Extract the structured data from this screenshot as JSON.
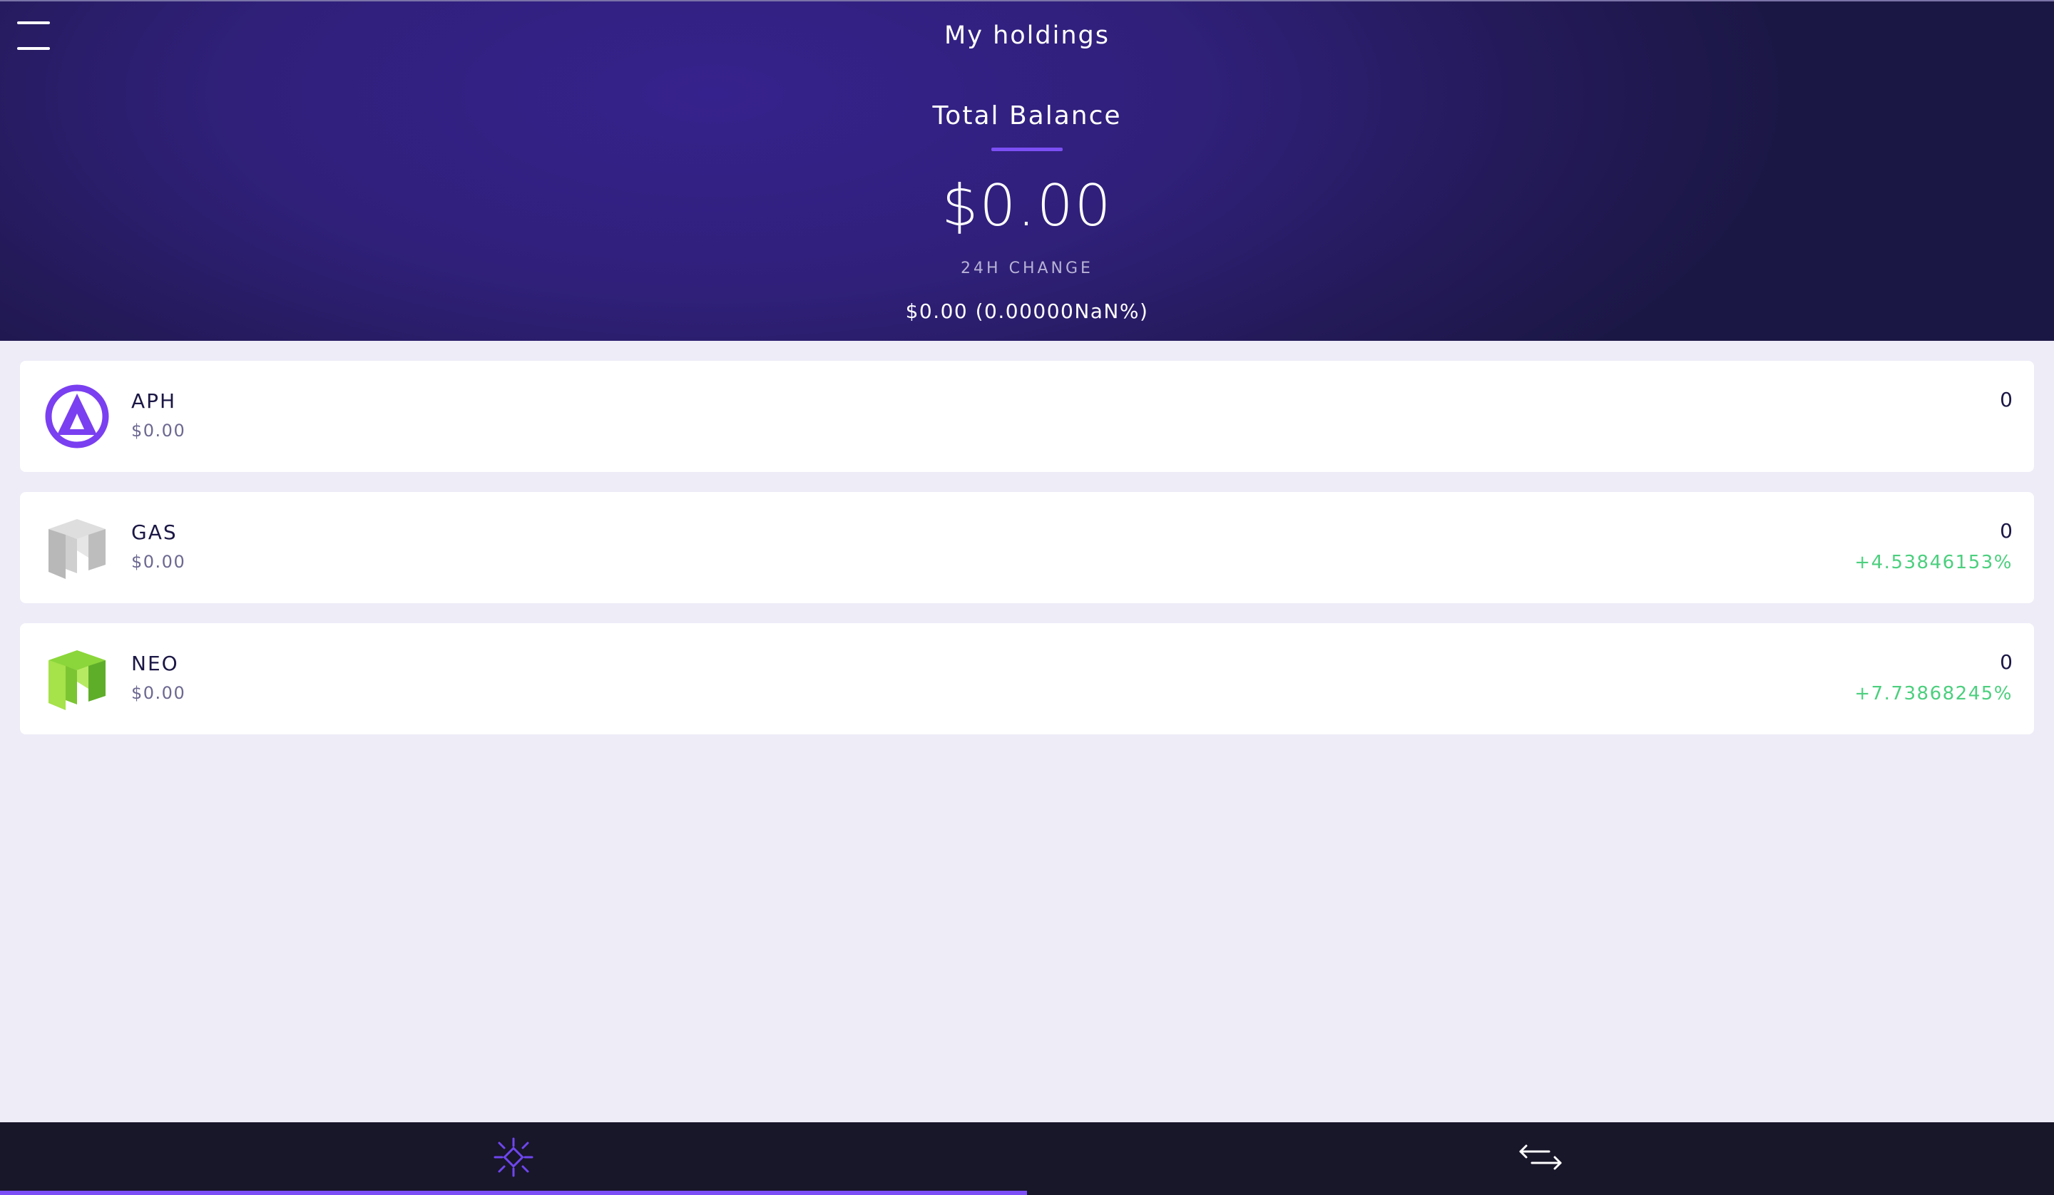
{
  "header": {
    "title": "My holdings",
    "balance_label": "Total Balance",
    "balance_value": "$0.00",
    "change_label": "24H CHANGE",
    "change_value": "$0.00 (0.00000NaN%)"
  },
  "colors": {
    "header_bg": "#30207a",
    "accent": "#7b4ff5",
    "positive": "#4ccf7e",
    "page_bg": "#edecf7",
    "nav_bg": "#181629"
  },
  "holdings": [
    {
      "symbol": "APH",
      "fiat": "$0.00",
      "amount": "0",
      "change": "",
      "icon": "aph-logo-icon"
    },
    {
      "symbol": "GAS",
      "fiat": "$0.00",
      "amount": "0",
      "change": "+4.53846153%",
      "icon": "gas-logo-icon"
    },
    {
      "symbol": "NEO",
      "fiat": "$0.00",
      "amount": "0",
      "change": "+7.73868245%",
      "icon": "neo-logo-icon"
    }
  ],
  "nav": {
    "tabs": [
      {
        "icon": "holdings-sparkle-icon",
        "active": true
      },
      {
        "icon": "transfer-arrows-icon",
        "active": false
      }
    ]
  }
}
